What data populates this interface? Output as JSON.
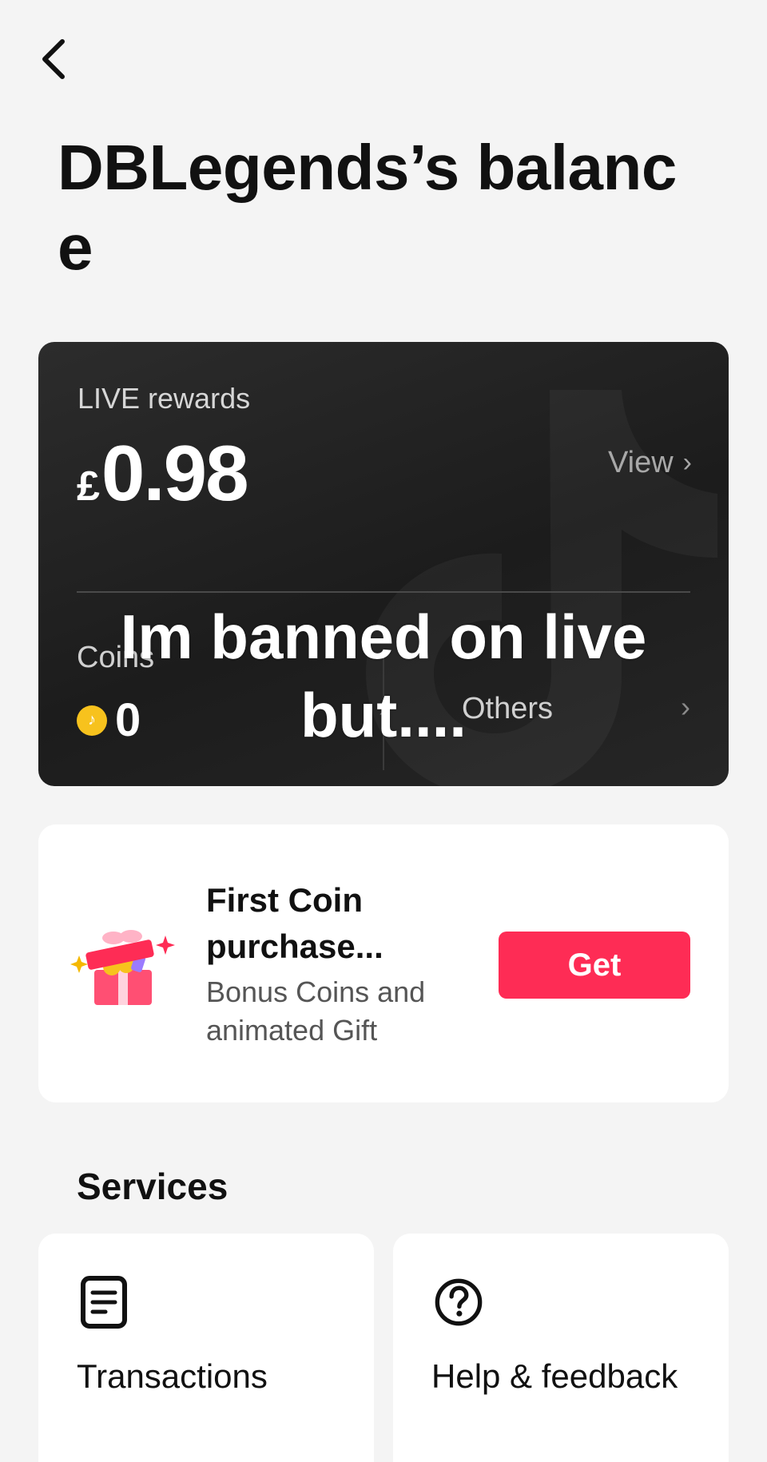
{
  "header": {
    "title": "DBLegends’s balance",
    "back_icon": "chevron-left-icon"
  },
  "balance_card": {
    "rewards_label": "LIVE rewards",
    "currency_symbol": "£",
    "amount": "0.98",
    "view_label": "View",
    "chevron": "›",
    "coins_label": "Coins",
    "coins_value": "0",
    "coin_icon": "tiktok-coin-icon",
    "others_label": "Others",
    "watermark_icon": "tiktok-logo-icon"
  },
  "overlay": {
    "caption": "Im banned on live but...."
  },
  "promo": {
    "title": "First Coin purchase...",
    "subtitle": "Bonus Coins and animated Gift",
    "button_label": "Get",
    "icon": "gift-box-icon",
    "accent_color": "#fe2c55"
  },
  "services": {
    "heading": "Services",
    "items": [
      {
        "label": "Transactions",
        "icon": "document-icon"
      },
      {
        "label": "Help & feedback",
        "icon": "question-circle-icon"
      }
    ]
  }
}
